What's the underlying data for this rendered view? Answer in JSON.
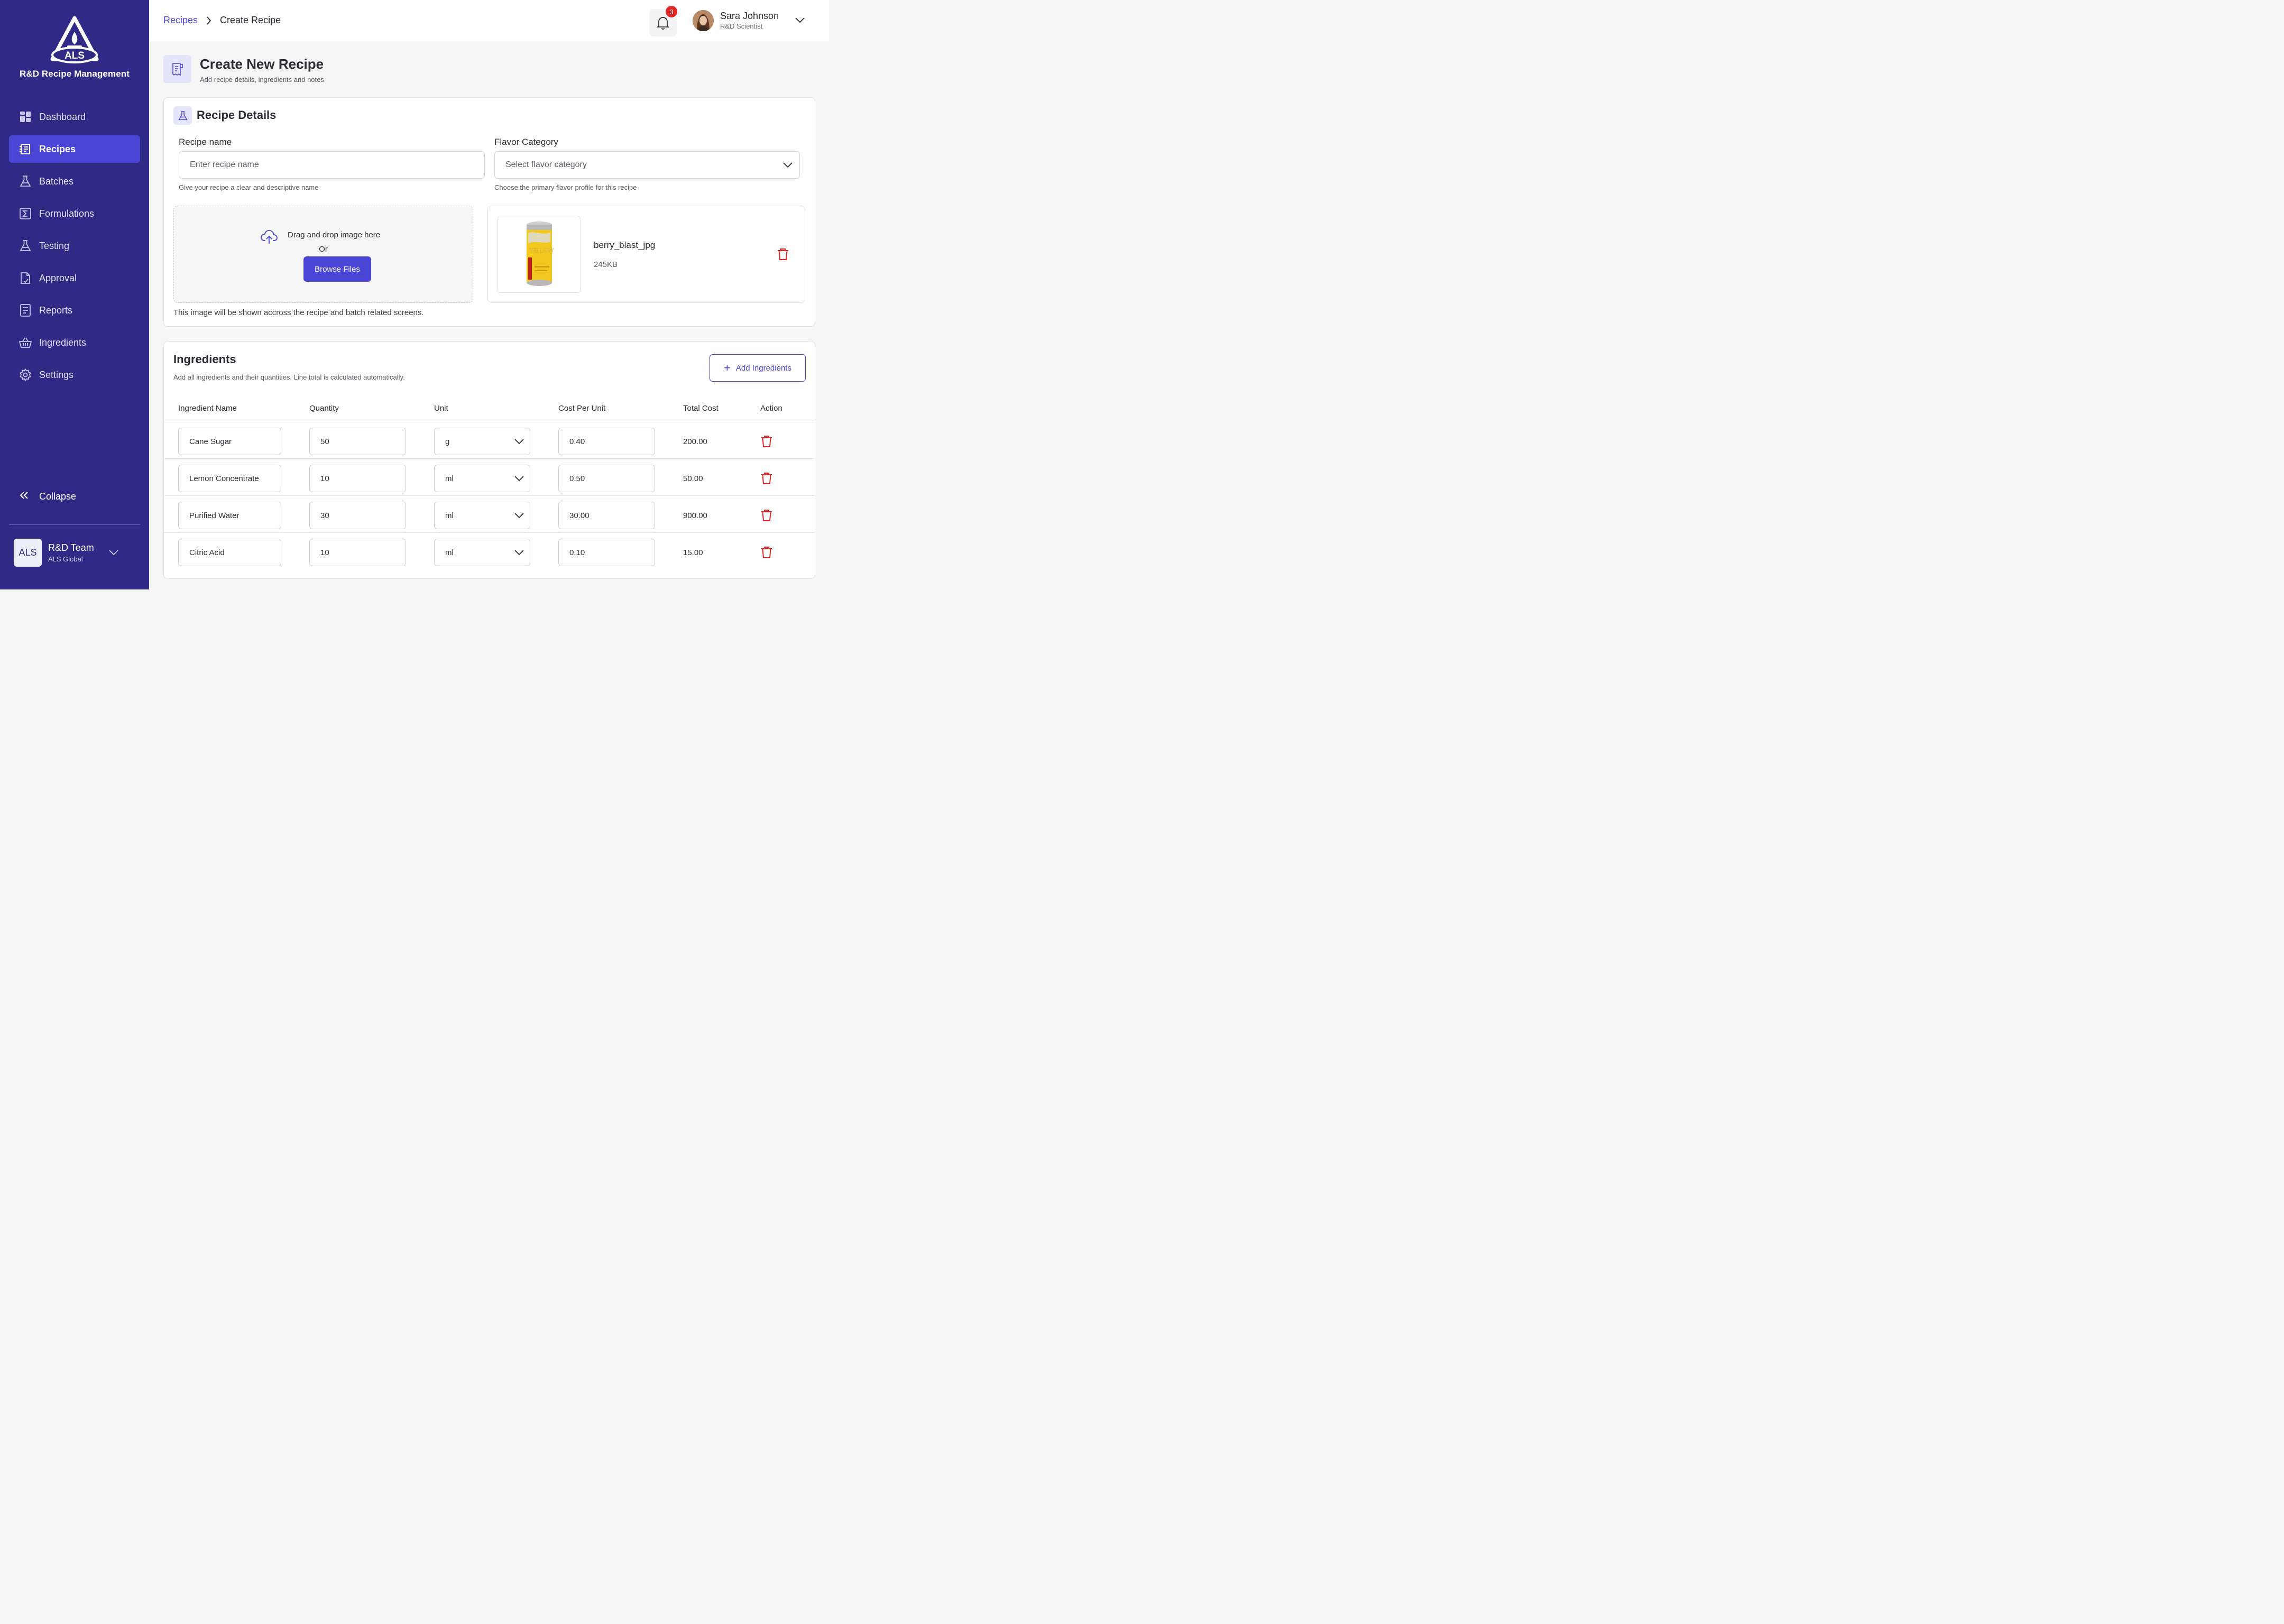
{
  "brand": {
    "logo_text": "ALS",
    "title": "R&D Recipe Management"
  },
  "sidebar": {
    "items": [
      {
        "label": "Dashboard",
        "icon": "dashboard-icon",
        "active": false
      },
      {
        "label": "Recipes",
        "icon": "recipe-book-icon",
        "active": true
      },
      {
        "label": "Batches",
        "icon": "flask-icon",
        "active": false
      },
      {
        "label": "Formulations",
        "icon": "sigma-icon",
        "active": false
      },
      {
        "label": "Testing",
        "icon": "flask-icon",
        "active": false
      },
      {
        "label": "Approval",
        "icon": "document-check-icon",
        "active": false
      },
      {
        "label": "Reports",
        "icon": "report-icon",
        "active": false
      },
      {
        "label": "Ingredients",
        "icon": "basket-icon",
        "active": false
      },
      {
        "label": "Settings",
        "icon": "gear-icon",
        "active": false
      }
    ],
    "collapse_label": "Collapse",
    "team": {
      "logo": "ALS",
      "name": "R&D Team",
      "org": "ALS Global"
    }
  },
  "header": {
    "breadcrumb": {
      "parent": "Recipes",
      "current": "Create Recipe"
    },
    "notifications_count": "3",
    "user": {
      "name": "Sara Johnson",
      "role": "R&D Scientist"
    }
  },
  "page": {
    "title": "Create New Recipe",
    "subtitle": "Add recipe details, ingredients and notes"
  },
  "recipe_details": {
    "section_title": "Recipe Details",
    "recipe_name": {
      "label": "Recipe name",
      "placeholder": "Enter recipe name",
      "hint": "Give your recipe a clear and descriptive name"
    },
    "flavor_category": {
      "label": "Flavor Category",
      "placeholder": "Select flavor category",
      "hint": "Choose the primary flavor profile for this recipe"
    },
    "upload": {
      "drag_text": "Drag and drop image here",
      "or_text": "Or",
      "browse_label": "Browse Files",
      "note": "This image will be shown accross the recipe and batch related screens."
    },
    "file": {
      "name": "berry_blast_jpg",
      "size": "245KB",
      "can_label": "YELLOW"
    }
  },
  "ingredients": {
    "title": "Ingredients",
    "subtitle": "Add all ingredients and their quantities. Line total is calculated automatically.",
    "add_label": "Add Ingredients",
    "columns": [
      "Ingredient Name",
      "Quantity",
      "Unit",
      "Cost Per Unit",
      "Total Cost",
      "Action"
    ],
    "rows": [
      {
        "name": "Cane Sugar",
        "quantity": "50",
        "unit": "g",
        "cost_per_unit": "0.40",
        "total": "200.00"
      },
      {
        "name": "Lemon Concentrate",
        "quantity": "10",
        "unit": "ml",
        "cost_per_unit": "0.50",
        "total": "50.00"
      },
      {
        "name": "Purified Water",
        "quantity": "30",
        "unit": "ml",
        "cost_per_unit": "30.00",
        "total": "900.00"
      },
      {
        "name": "Citric Acid",
        "quantity": "10",
        "unit": "ml",
        "cost_per_unit": "0.10",
        "total": "15.00"
      }
    ]
  },
  "colors": {
    "sidebar_bg": "#2e2a85",
    "accent": "#4b45d6",
    "danger": "#e02424",
    "page_bg": "#f5f6f5"
  }
}
